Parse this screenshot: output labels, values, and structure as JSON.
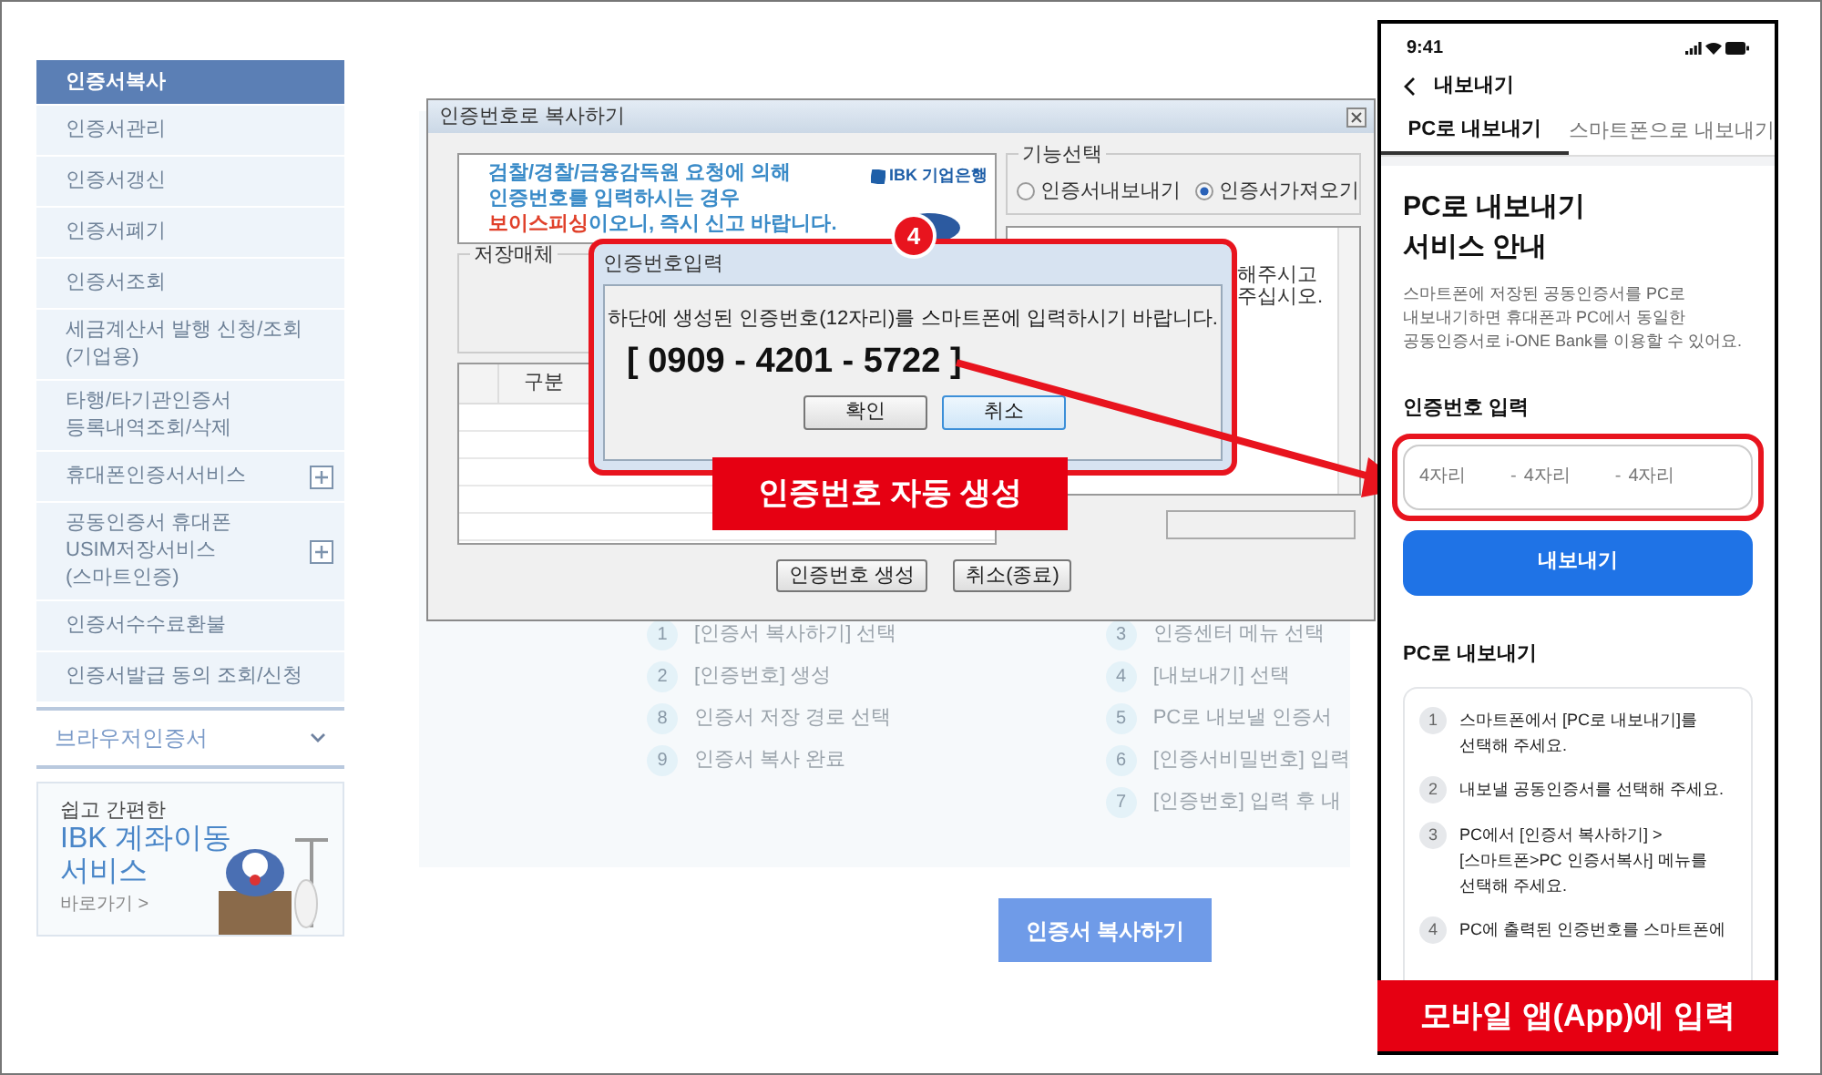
{
  "sidebar": {
    "items": [
      {
        "label": "인증서복사",
        "selected": true,
        "expandable": false
      },
      {
        "label": "인증서관리",
        "selected": false,
        "expandable": false
      },
      {
        "label": "인증서갱신",
        "selected": false,
        "expandable": false
      },
      {
        "label": "인증서폐기",
        "selected": false,
        "expandable": false
      },
      {
        "label": "인증서조회",
        "selected": false,
        "expandable": false
      },
      {
        "label": "세금계산서 발행 신청/조회(기업용)",
        "selected": false,
        "expandable": false
      },
      {
        "label": "타행/타기관인증서 등록내역조회/삭제",
        "selected": false,
        "expandable": false
      },
      {
        "label": "휴대폰인증서서비스",
        "selected": false,
        "expandable": true
      },
      {
        "label": "공동인증서 휴대폰 USIM저장서비스(스마트인증)",
        "selected": false,
        "expandable": true
      },
      {
        "label": "인증서수수료환불",
        "selected": false,
        "expandable": false
      },
      {
        "label": "인증서발급 동의 조회/신청",
        "selected": false,
        "expandable": false
      }
    ],
    "section": {
      "label": "브라우저인증서",
      "expanded": false
    },
    "promo": {
      "eyebrow": "쉽고 간편한",
      "title": "IBK 계좌이동 서비스",
      "link": "바로가기 >"
    }
  },
  "guide": {
    "left_steps": [
      {
        "number": "1",
        "text": "[인증서 복사하기] 선택"
      },
      {
        "number": "2",
        "text": "[인증번호] 생성"
      },
      {
        "number": "8",
        "text": "인증서 저장 경로 선택"
      },
      {
        "number": "9",
        "text": "인증서 복사 완료"
      }
    ],
    "right_steps": [
      {
        "number": "3",
        "text": "인증센터 메뉴 선택"
      },
      {
        "number": "4",
        "text": "[내보내기] 선택"
      },
      {
        "number": "5",
        "text": "PC로 내보낼 인증서"
      },
      {
        "number": "6",
        "text": "[인증서비밀번호] 입력"
      },
      {
        "number": "7",
        "text": "[인증번호] 입력 후 내"
      }
    ],
    "button": "인증서 복사하기"
  },
  "copy_dialog": {
    "title": "인증번호로 복사하기",
    "banner": {
      "lines": [
        "검찰/경찰/금융감독원 요청에 의해",
        "인증번호를 입력하시는 경우"
      ],
      "warning": "보이스피싱",
      "warning_rest": "이오니, 즉시 신고 바랍니다.",
      "logo": "IBK 기업은행"
    },
    "storage_label": "저장매체",
    "table_header": "구분",
    "function_label": "기능선택",
    "radios": [
      {
        "label": "인증서내보내기",
        "selected": false
      },
      {
        "label": "인증서가져오기",
        "selected": true
      }
    ],
    "notice_lines": [
      "해주시고",
      "주십시오."
    ],
    "buttons": [
      "인증번호 생성",
      "취소(종료)"
    ]
  },
  "code_dialog": {
    "title": "인증번호입력",
    "message": "하단에 생성된 인증번호(12자리)를 스마트폰에 입력하시기 바랍니다.",
    "code": "[ 0909 - 4201 - 5722 ]",
    "buttons": [
      {
        "label": "확인",
        "selected": false
      },
      {
        "label": "취소",
        "selected": true
      }
    ]
  },
  "callouts": {
    "badge": "4",
    "pc_label": "인증번호 자동 생성",
    "mobile_label": "모바일 앱(App)에 입력"
  },
  "phone": {
    "time": "9:41",
    "header": "내보내기",
    "tabs": [
      {
        "label": "PC로 내보내기",
        "selected": true
      },
      {
        "label": "스마트폰으로 내보내기",
        "selected": false
      }
    ],
    "title_lines": [
      "PC로 내보내기",
      "서비스 안내"
    ],
    "description": "스마트폰에 저장된 공동인증서를 PC로\n내보내기하면 휴대폰과 PC에서 동일한\n공동인증서로 i-ONE Bank를 이용할 수 있어요.",
    "code_label": "인증번호 입력",
    "code_fields": [
      {
        "placeholder": "4자리"
      },
      {
        "placeholder": "4자리"
      },
      {
        "placeholder": "4자리"
      }
    ],
    "separator": "-",
    "button": "내보내기",
    "section_title": "PC로 내보내기",
    "steps": [
      {
        "number": "1",
        "text": "스마트폰에서 [PC로 내보내기]를\n선택해 주세요."
      },
      {
        "number": "2",
        "text": "내보낼 공동인증서를 선택해 주세요."
      },
      {
        "number": "3",
        "text": "PC에서 [인증서 복사하기] >\n[스마트폰>PC 인증서복사] 메뉴를\n선택해 주세요."
      },
      {
        "number": "4",
        "text": "PC에 출력된 인증번호를 스마트폰에"
      }
    ]
  }
}
